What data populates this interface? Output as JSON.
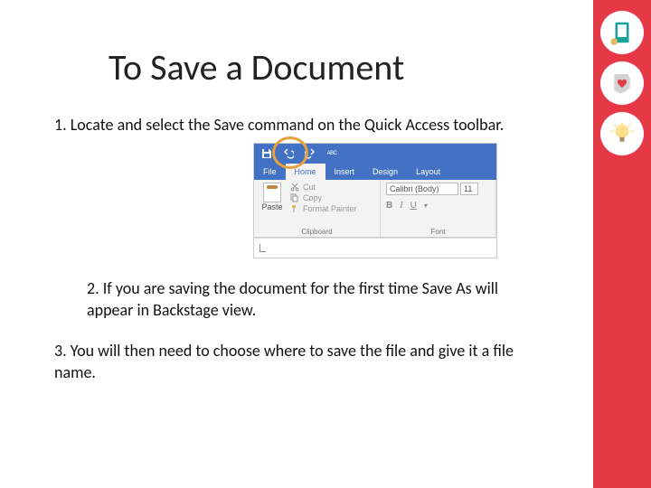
{
  "title": "To Save a Document",
  "steps": {
    "s1": "1.  Locate and select the Save command on the Quick Access toolbar.",
    "s2": "2.   If you are saving the document for the first time Save As will appear in Backstage view.",
    "s3": "3.  You will then need to choose where to save the file and give it a file name."
  },
  "word_ui": {
    "tabs": {
      "file": "File",
      "home": "Home",
      "insert": "Insert",
      "design": "Design",
      "layout": "Layout"
    },
    "clipboard": {
      "paste": "Paste",
      "cut": "Cut",
      "copy": "Copy",
      "painter": "Format Painter",
      "label": "Clipboard"
    },
    "font": {
      "name": "Calibri (Body)",
      "size": "11",
      "label": "Font",
      "b": "B",
      "i": "I",
      "u": "U"
    }
  }
}
